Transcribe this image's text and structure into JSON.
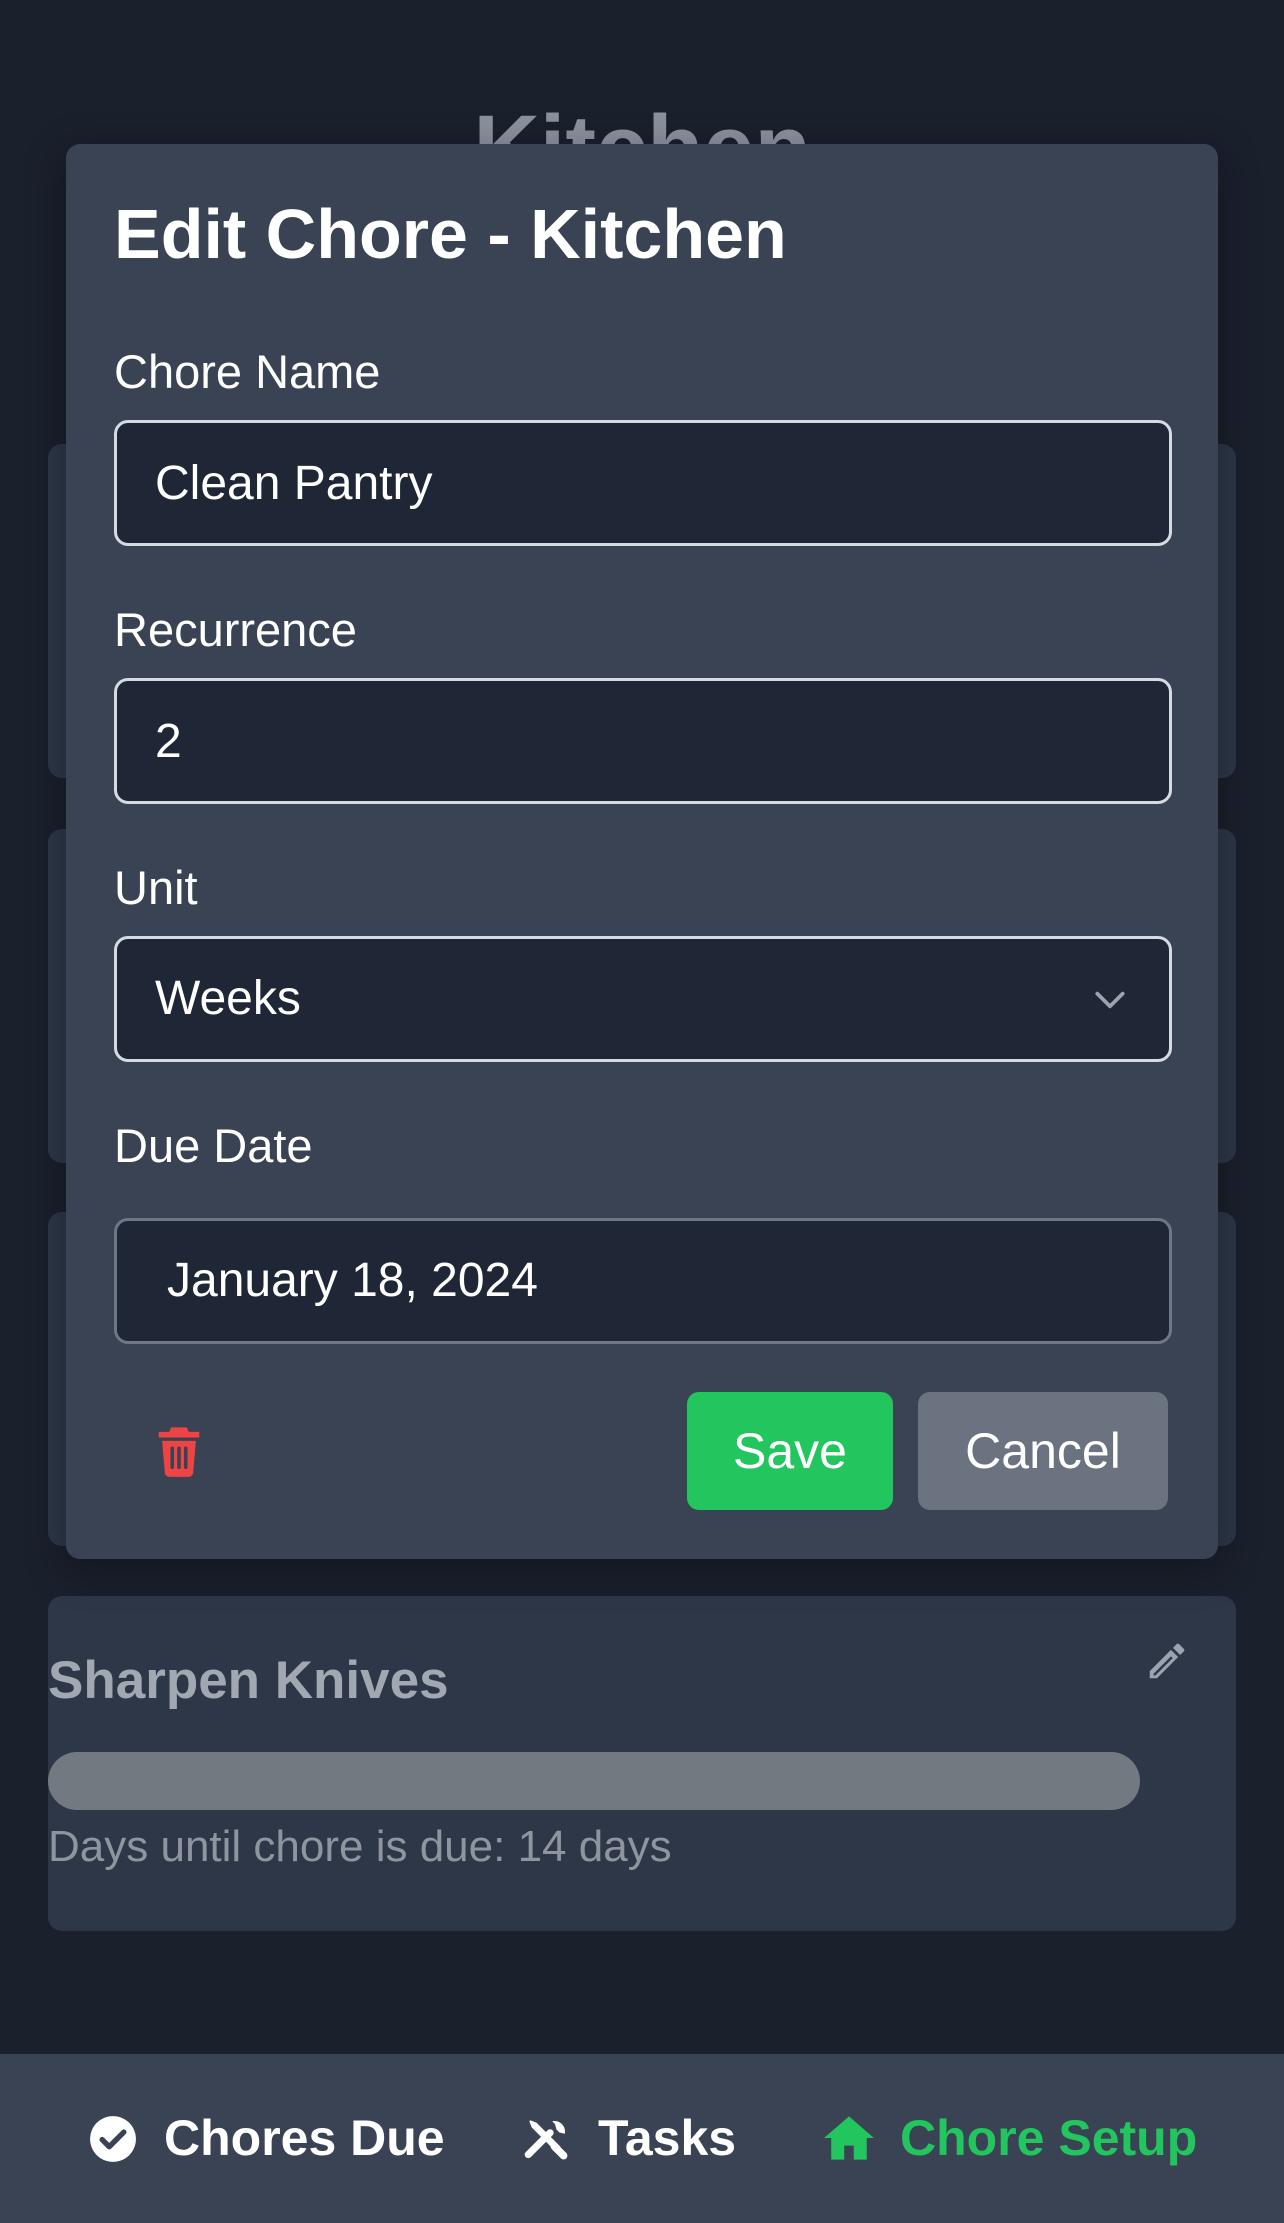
{
  "background": {
    "page_title": "Kitchen",
    "card": {
      "title": "Sharpen Knives",
      "due_text": "Days until chore is due: 14 days"
    }
  },
  "modal": {
    "title": "Edit Chore - Kitchen",
    "chore_name": {
      "label": "Chore Name",
      "value": "Clean Pantry"
    },
    "recurrence": {
      "label": "Recurrence",
      "value": "2"
    },
    "unit": {
      "label": "Unit",
      "value": "Weeks"
    },
    "due_date": {
      "label": "Due Date",
      "value": "January 18, 2024"
    },
    "save_label": "Save",
    "cancel_label": "Cancel",
    "delete_icon": "trash-icon"
  },
  "bottom_nav": {
    "items": [
      {
        "label": "Chores Due",
        "icon": "check-circle-icon",
        "active": false
      },
      {
        "label": "Tasks",
        "icon": "tools-icon",
        "active": false
      },
      {
        "label": "Chore Setup",
        "icon": "home-icon",
        "active": true
      }
    ]
  },
  "colors": {
    "accent": "#22c55e",
    "danger": "#ef4444",
    "background": "#1a202c",
    "modal": "#3a4354",
    "card": "#2d3748"
  }
}
